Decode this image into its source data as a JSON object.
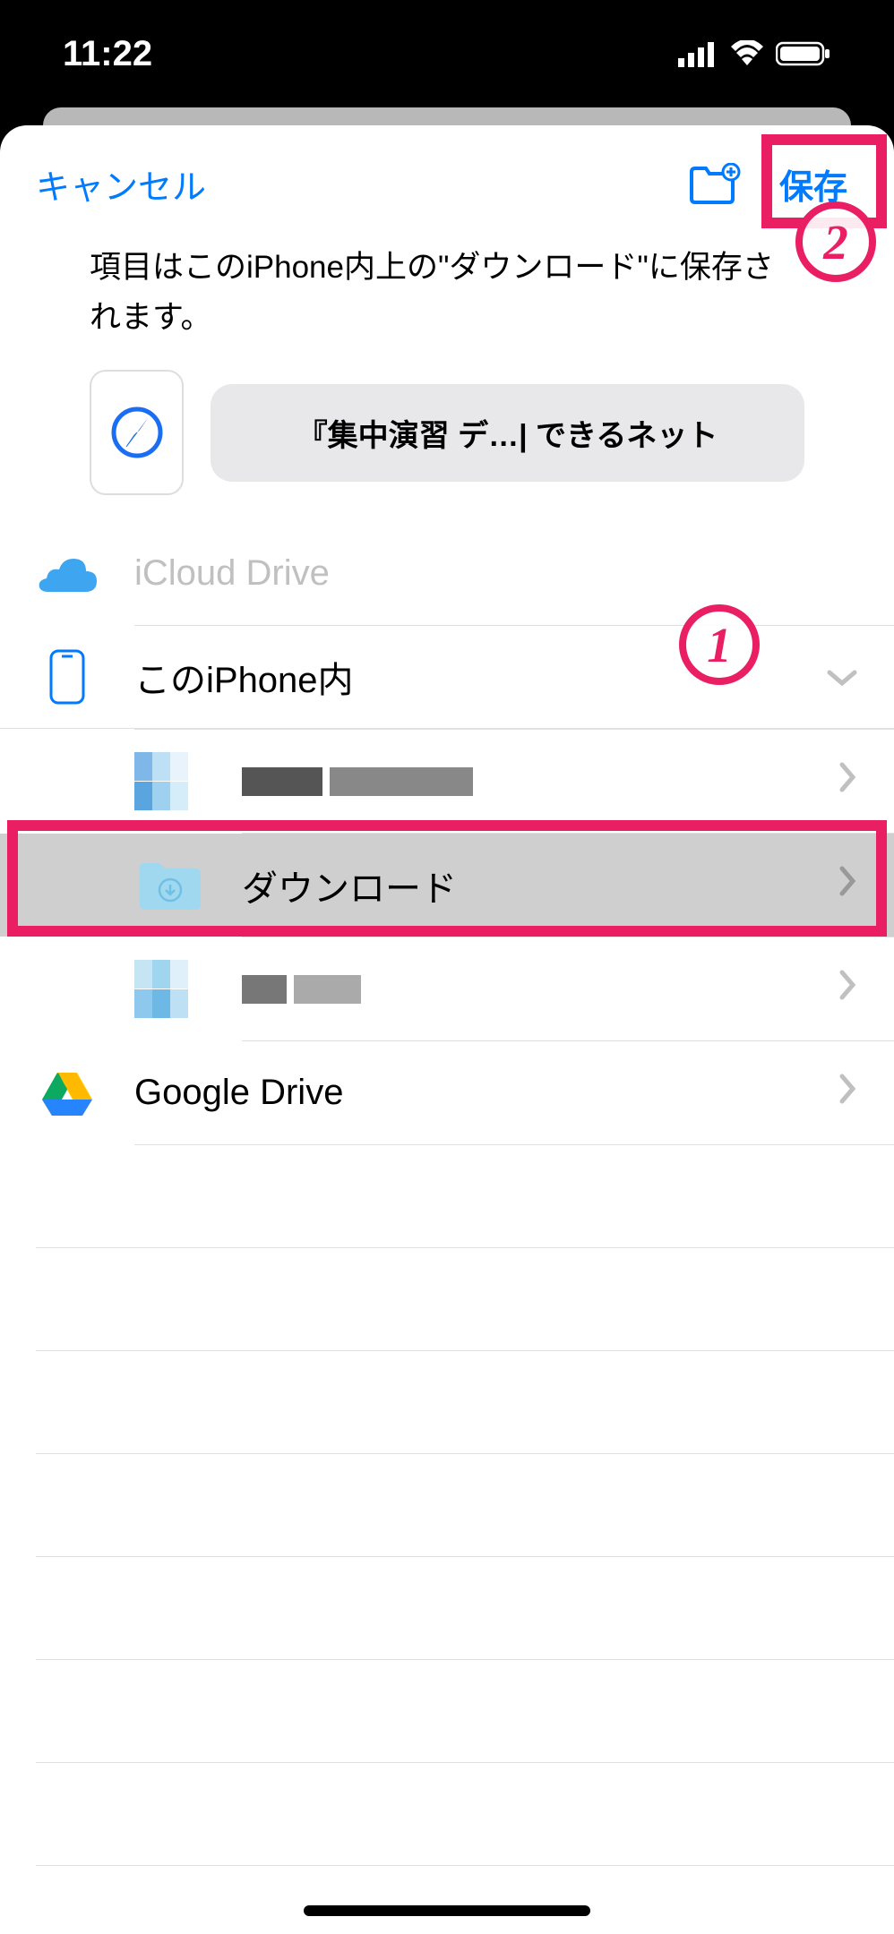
{
  "status": {
    "time": "11:22"
  },
  "nav": {
    "cancel": "キャンセル",
    "save": "保存"
  },
  "description": "項目はこのiPhone内上の\"ダウンロード\"に保存されます。",
  "file": {
    "title": "『集中演習 デ…| できるネット"
  },
  "locations": {
    "icloud": "iCloud Drive",
    "iphone": "このiPhone内",
    "downloads": "ダウンロード",
    "gdrive": "Google Drive"
  },
  "annotations": {
    "badge1": "1",
    "badge2": "2"
  }
}
